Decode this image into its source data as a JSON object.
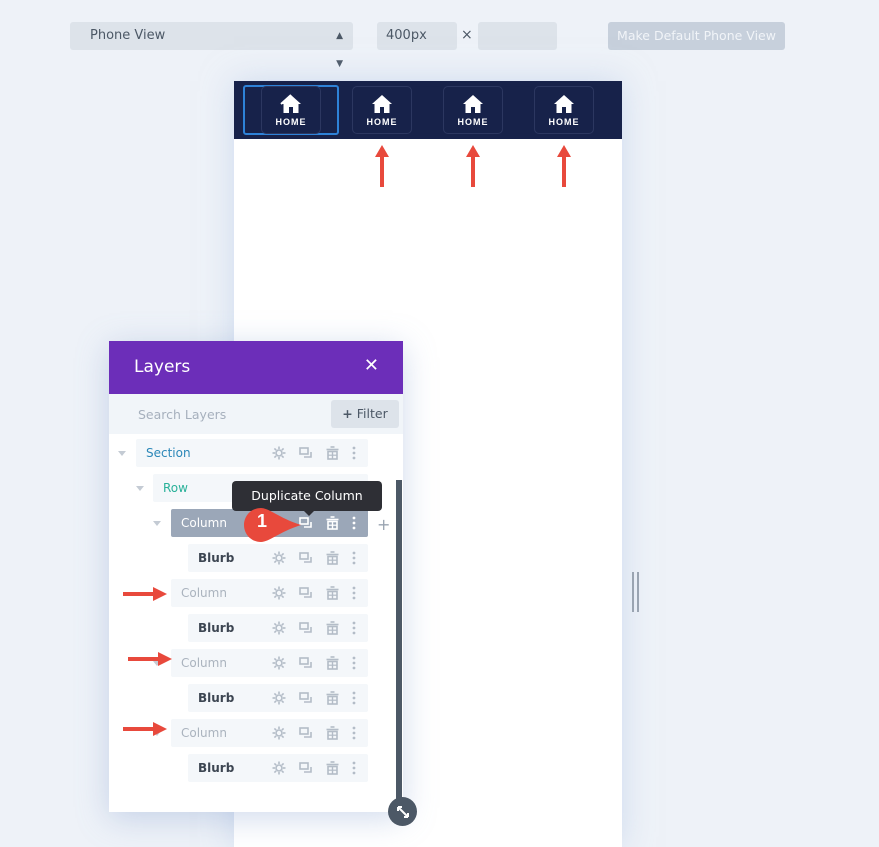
{
  "toolbar": {
    "view_select": {
      "value": "Phone View",
      "icon": "updown-arrows-icon"
    },
    "width_value": "400px",
    "dimension_separator": "×",
    "height_value": "",
    "make_default_label": "Make Default Phone View"
  },
  "canvas": {
    "navbar_color": "#17224a",
    "nav_items": [
      {
        "label": "HOME",
        "icon": "home-icon",
        "selected": true
      },
      {
        "label": "HOME",
        "icon": "home-icon",
        "selected": false
      },
      {
        "label": "HOME",
        "icon": "home-icon",
        "selected": false
      },
      {
        "label": "HOME",
        "icon": "home-icon",
        "selected": false
      }
    ],
    "annotation_arrow_color": "#e8493c"
  },
  "layers": {
    "title": "Layers",
    "close_icon": "close-icon",
    "search_placeholder": "Search Layers",
    "filter_label": "Filter",
    "filter_icon": "plus-icon",
    "accent_color": "#6c2eb9",
    "tree": [
      {
        "type": "section",
        "label": "Section",
        "collapsible": true
      },
      {
        "type": "row",
        "label": "Row",
        "collapsible": true
      },
      {
        "type": "column",
        "label": "Column",
        "collapsible": true,
        "active": true
      },
      {
        "type": "blurb",
        "label": "Blurb"
      },
      {
        "type": "column",
        "label": "Column",
        "annotated": true
      },
      {
        "type": "blurb",
        "label": "Blurb"
      },
      {
        "type": "column",
        "label": "Column",
        "annotated": true
      },
      {
        "type": "blurb",
        "label": "Blurb"
      },
      {
        "type": "column",
        "label": "Column",
        "annotated": true
      },
      {
        "type": "blurb",
        "label": "Blurb"
      }
    ],
    "row_actions": [
      "gear-icon",
      "duplicate-icon",
      "trash-icon",
      "more-vertical-icon"
    ],
    "tooltip": "Duplicate Column",
    "step_badge": "1",
    "add_icon": "+"
  }
}
